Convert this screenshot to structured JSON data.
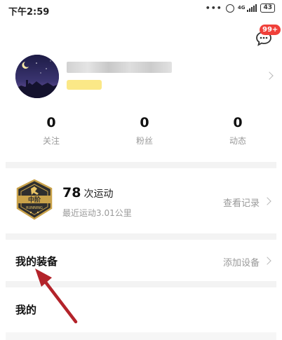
{
  "status_bar": {
    "time": "下午2:59",
    "dots": "•••",
    "network": "4G",
    "battery": "43",
    "icons": [
      "alarm-icon",
      "signal-icon",
      "battery-icon"
    ]
  },
  "header": {
    "message_badge": "99+",
    "message_icon": "chat-bubble-icon",
    "badge_color": "#f0403a"
  },
  "profile": {
    "avatar_icon": "night-sky-avatar"
  },
  "stats": [
    {
      "value": "0",
      "label": "关注"
    },
    {
      "value": "0",
      "label": "粉丝"
    },
    {
      "value": "0",
      "label": "动态"
    }
  ],
  "sport": {
    "badge_level": "中阶",
    "badge_sub": "RUNNING",
    "count": "78",
    "count_unit": "次运动",
    "recent": "最近运动3.01公里",
    "link": "查看记录"
  },
  "equipment": {
    "title": "我的装备",
    "link": "添加设备"
  },
  "mine": {
    "title": "我的"
  },
  "annotation": {
    "arrow_color": "#b3232a",
    "arrow_icon": "red-arrow-annotation"
  }
}
